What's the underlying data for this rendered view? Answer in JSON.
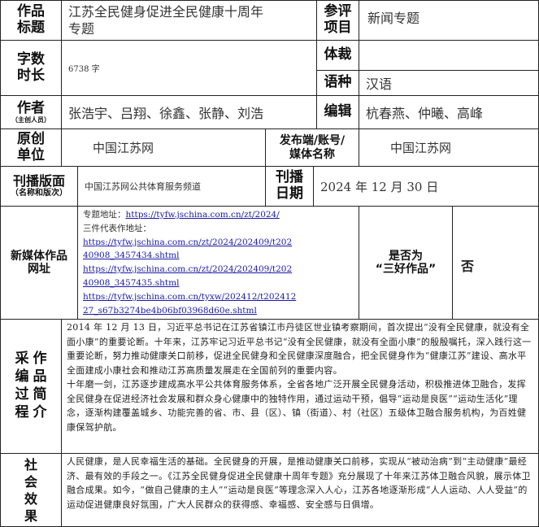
{
  "row1": {
    "works_label_l1": "作品",
    "works_label_l2": "标题",
    "works_title_l1": "江苏全民健身促进全民健康十周年",
    "works_title_l2": "专题",
    "entry_label_l1": "参评",
    "entry_label_l2": "项目",
    "entry_value": "新闻专题"
  },
  "row2": {
    "count_label_l1": "字数",
    "count_label_l2": "时长",
    "count_value": "6738 字",
    "genre_label": "体裁",
    "genre_value": "",
    "lang_label": "语种",
    "lang_value": "汉语"
  },
  "row3": {
    "author_label": "作者",
    "author_sub": "（主创人员）",
    "authors": "张浩宇、吕翔、徐鑫、张静、刘浩",
    "editor_label": "编辑",
    "editors": "杭春燕、仲曦、高峰"
  },
  "row4": {
    "origin_label_l1": "原创",
    "origin_label_l2": "单位",
    "origin_value": "中国江苏网",
    "publish_label_l1": "发布端/账号/",
    "publish_label_l2": "媒体名称",
    "publish_value": "中国江苏网"
  },
  "row5": {
    "edition_label": "刊播版面",
    "edition_sub": "（名称和版次）",
    "edition_value": "中国江苏网公共体育服务频道",
    "date_label_l1": "刊播",
    "date_label_l2": "日期",
    "date_value": "2024 年 12 月 30 日"
  },
  "row6": {
    "url_label_l1": "新媒体作品",
    "url_label_l2": "网址",
    "topic_prefix": "专题地址：",
    "topic_url": "https://tyfw.jschina.com.cn/zt/2024/",
    "reps_label": "三件代表作地址：",
    "rep1_l1": "https://tyfw.jschina.com.cn/zt/2024/202409/t202",
    "rep1_l2": "40908_3457434.shtml",
    "rep2_l1": "https://tyfw.jschina.com.cn/zt/2024/202409/t202",
    "rep2_l2": "40908_3457435.shtml",
    "rep3_l1": "https://tyfw.jschina.com.cn/tyxw/202412/t202412",
    "rep3_l2": "27_s67b3274be4b06bf03968d60e.shtml",
    "three_good_l1": "是否为",
    "three_good_l2": "“三好作品”",
    "three_good_value": "否"
  },
  "row7": {
    "process_label": [
      "采",
      "作",
      "编",
      "品",
      "过",
      "简",
      "程",
      "介"
    ],
    "para1": "2014 年 12 月 13 日，习近平总书记在江苏省镇江市丹徒区世业镇考察期间，首次提出“没有全民健康，就没有全面小康”的重要论断。十年来，江苏牢记习近平总书记“没有全民健康，就没有全面小康”的殷殷嘱托，深入践行这一重要论断，努力推动健康关口前移，促进全民健身和全民健康深度融合，把全民健身作为“健康江苏”建设、高水平全面建成小康社会和推动江苏高质量发展走在全国前列的重要内容。",
    "para2": "十年磨一剑，江苏逐步建成高水平公共体育服务体系，全省各地广泛开展全民健身活动，积极推进体卫融合，发挥全民健身在促进经济社会发展和群众身心健康中的独特作用，通过运动干预，倡导“运动是良医”“运动生活化”理念，逐渐构建覆盖城乡、功能完善的省、市、县（区）、镇（街道）、村（社区）五级体卫融合服务机构，为百姓健康保驾护航。"
  },
  "row8": {
    "effect_label": [
      "社",
      "会",
      "效",
      "果"
    ],
    "para": "人民健康，是人民幸福生活的基础。全民健身的开展，是推动健康关口前移，实现从“被动治病”到“主动健康”最经济、最有效的手段之一。《江苏全民健身促进全民健康十周年专题》充分展现了十年来江苏体卫融合风貌，展示体卫融合成果。如今，“做自己健康的主人”“运动是良医”等理念深入人心，江苏各地逐渐形成“人人运动、人人受益”的运动促进健康良好氛围，广大人民群众的获得感、幸福感、安全感与日俱增。"
  }
}
